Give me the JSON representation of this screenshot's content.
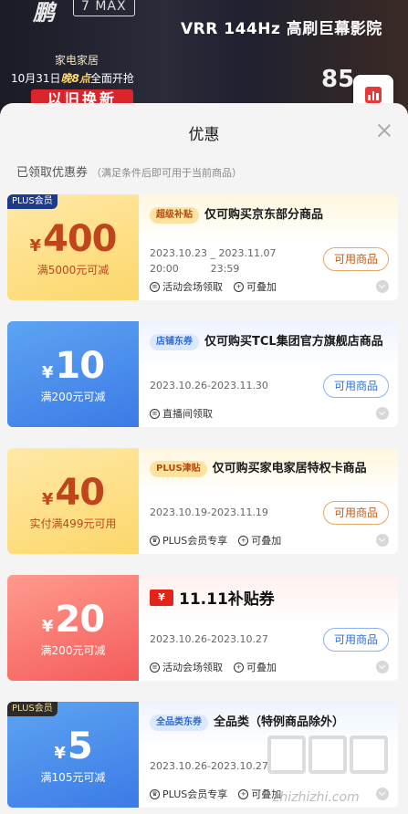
{
  "banner": {
    "logo": "鹏",
    "model": "7 MAX",
    "tagline": "VRR 144Hz 高刷巨幕影院",
    "promo_category": "家电家居",
    "promo_date_prefix": "10月31日",
    "promo_date_em": "晚8点",
    "promo_date_suffix": "全面开抢",
    "trade_in": "以旧换新",
    "size": "85",
    "chart_icon": "bar-chart-icon"
  },
  "sheet": {
    "title": "优惠",
    "close_icon": "close-icon",
    "section_title": "已领取优惠券",
    "section_note": "（满足条件后即可用于当前商品）"
  },
  "coupons": [
    {
      "plus_badge": "PLUS会员",
      "currency": "¥",
      "amount": "400",
      "condition": "满5000元可减",
      "tag": "超级补贴",
      "title": "仅可购买京东部分商品",
      "date_line1": "2023.10.23 _ 2023.11.07",
      "date_line2": "20:00          23:59",
      "button": "可用商品",
      "meta1": "活动会场领取",
      "meta2": "可叠加"
    },
    {
      "currency": "¥",
      "amount": "10",
      "condition": "满200元可减",
      "tag": "店铺东券",
      "title": "仅可购买TCL集团官方旗舰店商品",
      "date_line1": "2023.10.26-2023.11.30",
      "button": "可用商品",
      "meta1": "直播间领取"
    },
    {
      "currency": "¥",
      "amount": "40",
      "condition": "实付满499元可用",
      "tag": "PLUS津贴",
      "title": "仅可购买家电家居特权卡商品",
      "date_line1": "2023.10.19-2023.11.19",
      "button": "可用商品",
      "meta1": "PLUS会员专享",
      "meta2": "可叠加"
    },
    {
      "currency": "¥",
      "amount": "20",
      "condition": "满200元可减",
      "box": "¥",
      "title": "11.11补贴券",
      "date_line1": "2023.10.26-2023.10.27",
      "button": "可用商品",
      "meta1": "活动会场领取",
      "meta2": "可叠加"
    },
    {
      "plus_badge": "PLUS会员",
      "currency": "¥",
      "amount": "5",
      "condition": "满105元可减",
      "tag": "全品类东券",
      "title": "全品类（特例商品除外）",
      "date_line1": "2023.10.26-2023.10.27",
      "meta1": "PLUS会员专享",
      "meta2": "可叠加"
    }
  ],
  "watermark": "zhizhizhi.com"
}
